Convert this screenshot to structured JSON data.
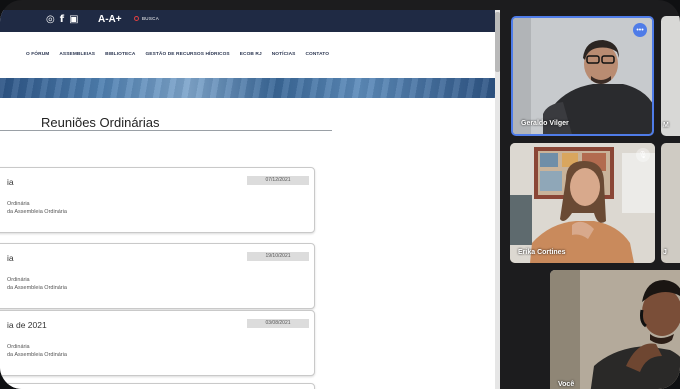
{
  "website": {
    "topbar": {
      "social_icons": [
        "instagram-icon",
        "facebook-icon",
        "youtube-icon"
      ],
      "icon_glyphs": [
        "◎",
        "f",
        "▣"
      ],
      "font_size_control": "A-A+",
      "search_label": "BUSCA"
    },
    "nav": [
      "O FÓRUM",
      "ASSEMBLEIAS",
      "BIBLIOTECA",
      "GESTÃO DE RECURSOS HÍDRICOS",
      "ECOB RJ",
      "NOTÍCIAS",
      "CONTATO"
    ],
    "page_title": "Reuniões Ordinárias",
    "cards": [
      {
        "title": "ia",
        "date": "07/12/2021",
        "line1": "Ordinária",
        "line2": "da Assembleia Ordinária"
      },
      {
        "title": "ia",
        "date": "19/10/2021",
        "line1": "Ordinária",
        "line2": "da Assembleia Ordinária"
      },
      {
        "title": "ia de 2021",
        "date": "03/08/2021",
        "line1": "Ordinária",
        "line2": "da Assembleia Ordinária"
      }
    ]
  },
  "participants": [
    {
      "name": "Geraldo Vilger"
    },
    {
      "name": "Erika Cortines"
    },
    {
      "name": "Você"
    }
  ],
  "partial_labels": {
    "right1": "M",
    "right2": "J"
  },
  "colors": {
    "topbar": "#1f2a44",
    "active_speaker_border": "#4f7ce8",
    "more_options_badge": "#4f7ce8"
  }
}
